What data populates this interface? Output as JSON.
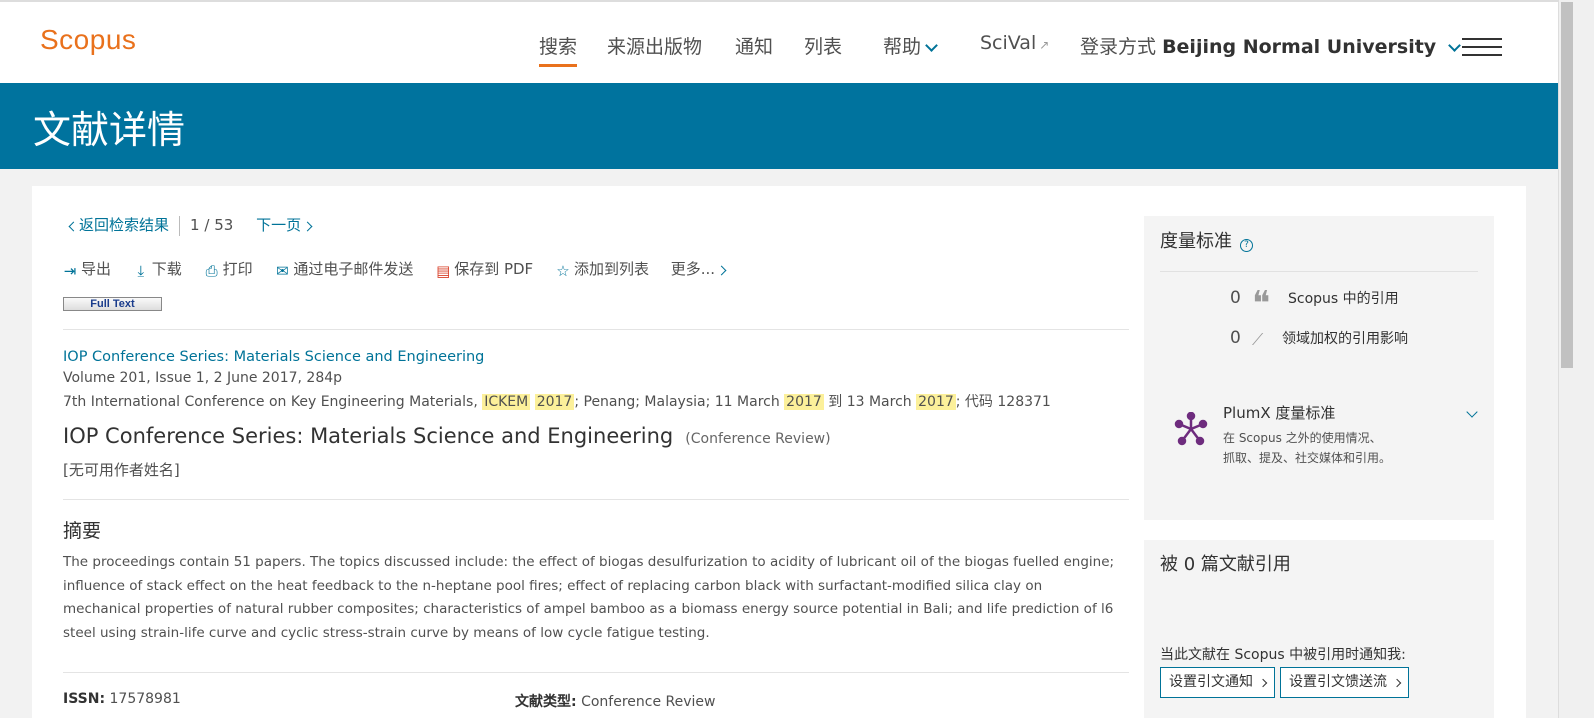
{
  "header": {
    "logo": "Scopus",
    "nav": {
      "search": "搜索",
      "sources": "来源出版物",
      "alerts": "通知",
      "lists": "列表",
      "help": "帮助",
      "scival": "SciVal",
      "login_prefix": "登录方式",
      "institution": "Beijing Normal University"
    }
  },
  "banner": {
    "title": "文献详情"
  },
  "results_nav": {
    "back": "返回检索结果",
    "position": "1",
    "slash": "/",
    "total": "53",
    "next": "下一页"
  },
  "actions": {
    "export": "导出",
    "download": "下载",
    "print": "打印",
    "email": "通过电子邮件发送",
    "save_pdf": "保存到 PDF",
    "add_list": "添加到列表",
    "more": "更多..."
  },
  "fulltext_button": "Full Text",
  "document": {
    "source_title": "IOP Conference Series: Materials Science and Engineering",
    "volume": "Volume 201, Issue 1, 2 June 2017, 284p",
    "conf_part1": "7th International Conference on Key Engineering Materials,",
    "conf_hl1": "ICKEM",
    "conf_hl2": "2017",
    "conf_part2": "; Penang; Malaysia; 11 March",
    "conf_hl3": "2017",
    "conf_part3": "到 13 March",
    "conf_hl4": "2017",
    "conf_part4": "; 代码 128371",
    "title": "IOP Conference Series: Materials Science and Engineering",
    "type_label": "(Conference Review)",
    "authors": "[无可用作者姓名]"
  },
  "abstract": {
    "heading": "摘要",
    "text": "The proceedings contain 51 papers. The topics discussed include: the effect of biogas desulfurization to acidity of lubricant oil of the biogas fuelled engine; influence of stack effect on the heat feedback to the n-heptane pool fires; effect of replacing carbon black with surfactant-modified silica clay on mechanical properties of natural rubber composites; characteristics of ampel bamboo as a biomass energy source potential in Bali; and life prediction of l6 steel using strain-life curve and cyclic stress-strain curve by means of low cycle fatigue testing."
  },
  "meta": {
    "issn_label": "ISSN:",
    "issn_value": "17578981",
    "doctype_label": "文献类型:",
    "doctype_value": "Conference Review"
  },
  "metrics": {
    "title": "度量标准",
    "citations_count": "0",
    "citations_label": "Scopus 中的引用",
    "fwci_count": "0",
    "fwci_label": "领域加权的引用影响",
    "plumx_title": "PlumX 度量标准",
    "plumx_desc": "在 Scopus 之外的使用情况、抓取、提及、社交媒体和引用。"
  },
  "cited_by": {
    "title": "被 0 篇文献引用",
    "notify_text": "当此文献在 Scopus 中被引用时通知我:",
    "btn_alert": "设置引文通知",
    "btn_feed": "设置引文馈送流"
  },
  "colors": {
    "brand": "#e9711c",
    "link": "#007398",
    "banner": "#00739e",
    "highlight": "#fcf09a"
  }
}
